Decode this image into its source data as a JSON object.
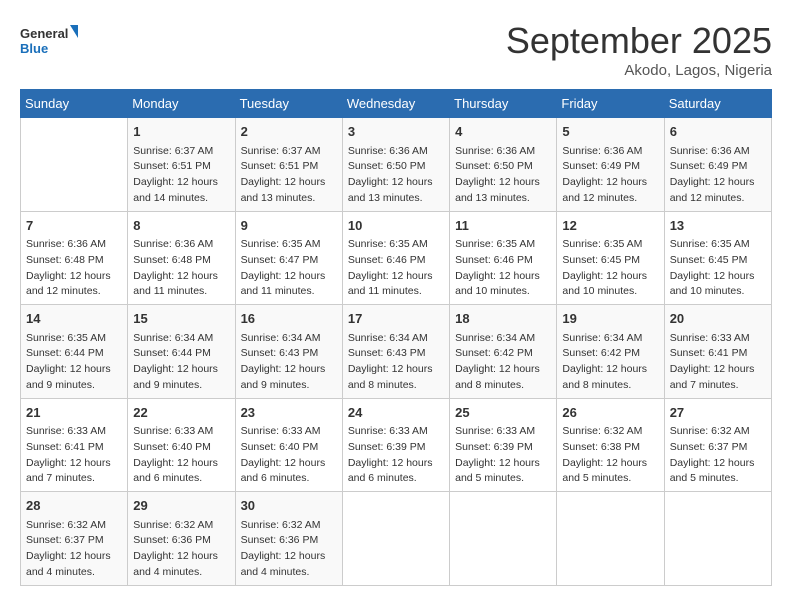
{
  "logo": {
    "line1": "General",
    "line2": "Blue"
  },
  "title": "September 2025",
  "subtitle": "Akodo, Lagos, Nigeria",
  "days_of_week": [
    "Sunday",
    "Monday",
    "Tuesday",
    "Wednesday",
    "Thursday",
    "Friday",
    "Saturday"
  ],
  "weeks": [
    [
      {
        "day": "",
        "info": ""
      },
      {
        "day": "1",
        "info": "Sunrise: 6:37 AM\nSunset: 6:51 PM\nDaylight: 12 hours\nand 14 minutes."
      },
      {
        "day": "2",
        "info": "Sunrise: 6:37 AM\nSunset: 6:51 PM\nDaylight: 12 hours\nand 13 minutes."
      },
      {
        "day": "3",
        "info": "Sunrise: 6:36 AM\nSunset: 6:50 PM\nDaylight: 12 hours\nand 13 minutes."
      },
      {
        "day": "4",
        "info": "Sunrise: 6:36 AM\nSunset: 6:50 PM\nDaylight: 12 hours\nand 13 minutes."
      },
      {
        "day": "5",
        "info": "Sunrise: 6:36 AM\nSunset: 6:49 PM\nDaylight: 12 hours\nand 12 minutes."
      },
      {
        "day": "6",
        "info": "Sunrise: 6:36 AM\nSunset: 6:49 PM\nDaylight: 12 hours\nand 12 minutes."
      }
    ],
    [
      {
        "day": "7",
        "info": ""
      },
      {
        "day": "8",
        "info": "Sunrise: 6:36 AM\nSunset: 6:48 PM\nDaylight: 12 hours\nand 11 minutes."
      },
      {
        "day": "9",
        "info": "Sunrise: 6:35 AM\nSunset: 6:47 PM\nDaylight: 12 hours\nand 11 minutes."
      },
      {
        "day": "10",
        "info": "Sunrise: 6:35 AM\nSunset: 6:46 PM\nDaylight: 12 hours\nand 11 minutes."
      },
      {
        "day": "11",
        "info": "Sunrise: 6:35 AM\nSunset: 6:46 PM\nDaylight: 12 hours\nand 10 minutes."
      },
      {
        "day": "12",
        "info": "Sunrise: 6:35 AM\nSunset: 6:45 PM\nDaylight: 12 hours\nand 10 minutes."
      },
      {
        "day": "13",
        "info": "Sunrise: 6:35 AM\nSunset: 6:45 PM\nDaylight: 12 hours\nand 10 minutes."
      }
    ],
    [
      {
        "day": "14",
        "info": ""
      },
      {
        "day": "15",
        "info": "Sunrise: 6:34 AM\nSunset: 6:44 PM\nDaylight: 12 hours\nand 9 minutes."
      },
      {
        "day": "16",
        "info": "Sunrise: 6:34 AM\nSunset: 6:43 PM\nDaylight: 12 hours\nand 9 minutes."
      },
      {
        "day": "17",
        "info": "Sunrise: 6:34 AM\nSunset: 6:43 PM\nDaylight: 12 hours\nand 8 minutes."
      },
      {
        "day": "18",
        "info": "Sunrise: 6:34 AM\nSunset: 6:42 PM\nDaylight: 12 hours\nand 8 minutes."
      },
      {
        "day": "19",
        "info": "Sunrise: 6:34 AM\nSunset: 6:42 PM\nDaylight: 12 hours\nand 8 minutes."
      },
      {
        "day": "20",
        "info": "Sunrise: 6:33 AM\nSunset: 6:41 PM\nDaylight: 12 hours\nand 7 minutes."
      }
    ],
    [
      {
        "day": "21",
        "info": ""
      },
      {
        "day": "22",
        "info": "Sunrise: 6:33 AM\nSunset: 6:40 PM\nDaylight: 12 hours\nand 6 minutes."
      },
      {
        "day": "23",
        "info": "Sunrise: 6:33 AM\nSunset: 6:40 PM\nDaylight: 12 hours\nand 6 minutes."
      },
      {
        "day": "24",
        "info": "Sunrise: 6:33 AM\nSunset: 6:39 PM\nDaylight: 12 hours\nand 6 minutes."
      },
      {
        "day": "25",
        "info": "Sunrise: 6:33 AM\nSunset: 6:39 PM\nDaylight: 12 hours\nand 5 minutes."
      },
      {
        "day": "26",
        "info": "Sunrise: 6:32 AM\nSunset: 6:38 PM\nDaylight: 12 hours\nand 5 minutes."
      },
      {
        "day": "27",
        "info": "Sunrise: 6:32 AM\nSunset: 6:37 PM\nDaylight: 12 hours\nand 5 minutes."
      }
    ],
    [
      {
        "day": "28",
        "info": "Sunrise: 6:32 AM\nSunset: 6:37 PM\nDaylight: 12 hours\nand 4 minutes."
      },
      {
        "day": "29",
        "info": "Sunrise: 6:32 AM\nSunset: 6:36 PM\nDaylight: 12 hours\nand 4 minutes."
      },
      {
        "day": "30",
        "info": "Sunrise: 6:32 AM\nSunset: 6:36 PM\nDaylight: 12 hours\nand 4 minutes."
      },
      {
        "day": "",
        "info": ""
      },
      {
        "day": "",
        "info": ""
      },
      {
        "day": "",
        "info": ""
      },
      {
        "day": "",
        "info": ""
      }
    ]
  ],
  "week1_sun_info": "Sunrise: 6:36 AM\nSunset: 6:48 PM\nDaylight: 12 hours\nand 12 minutes.",
  "week2_sun_info": "Sunrise: 6:36 AM\nSunset: 6:48 PM\nDaylight: 12 hours\nand 11 minutes.",
  "week3_sun_info": "Sunrise: 6:35 AM\nSunset: 6:44 PM\nDaylight: 12 hours\nand 9 minutes.",
  "week4_sun_info": "Sunrise: 6:33 AM\nSunset: 6:41 PM\nDaylight: 12 hours\nand 7 minutes."
}
